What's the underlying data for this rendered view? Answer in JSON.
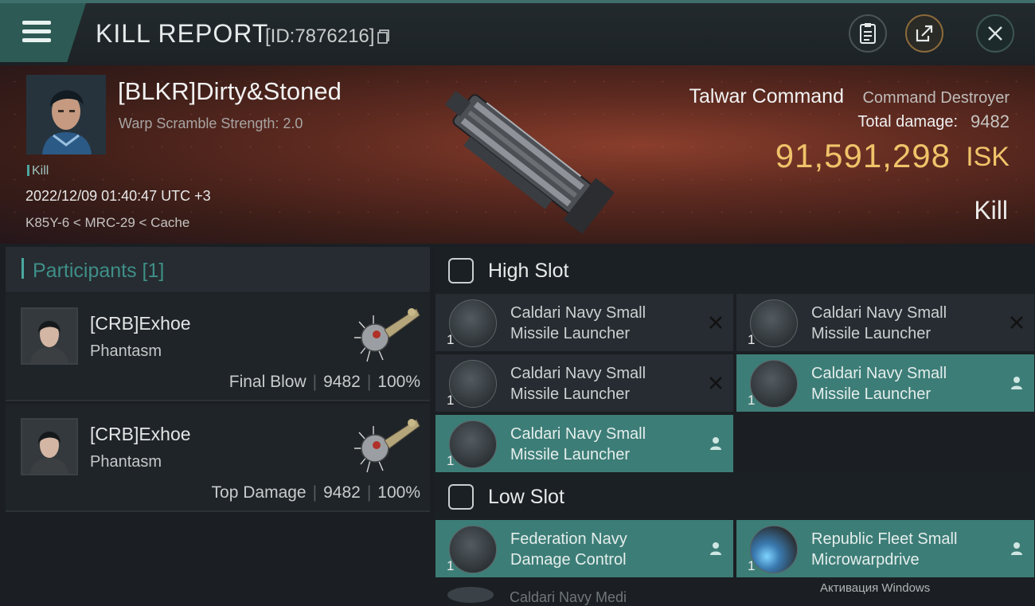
{
  "header": {
    "title": "KILL REPORT",
    "report_id": "[ID:7876216]"
  },
  "victim": {
    "name": "[BLKR]Dirty&Stoned",
    "sub": "Warp Scramble Strength: 2.0",
    "tag": "Kill",
    "datetime": "2022/12/09 01:40:47 UTC +3",
    "location": "K85Y-6 < MRC-29 < Cache"
  },
  "ship": {
    "name": "Talwar Command",
    "class": "Command Destroyer",
    "damage_label": "Total damage:",
    "damage_value": "9482",
    "isk_value": "91,591,298",
    "isk_unit": "ISK",
    "outcome": "Kill"
  },
  "participants": {
    "title": "Participants [1]",
    "rows": [
      {
        "name": "[CRB]Exhoe",
        "ship": "Phantasm",
        "label": "Final Blow",
        "damage": "9482",
        "percent": "100%"
      },
      {
        "name": "[CRB]Exhoe",
        "ship": "Phantasm",
        "label": "Top Damage",
        "damage": "9482",
        "percent": "100%"
      }
    ]
  },
  "high_slot": {
    "title": "High Slot",
    "modules": [
      {
        "line1": "Caldari Navy Small",
        "line2": "Missile Launcher",
        "qty": "1",
        "status": "destroyed"
      },
      {
        "line1": "Caldari Navy Small",
        "line2": "Missile Launcher",
        "qty": "1",
        "status": "destroyed"
      },
      {
        "line1": "Caldari Navy Small",
        "line2": "Missile Launcher",
        "qty": "1",
        "status": "destroyed"
      },
      {
        "line1": "Caldari Navy Small",
        "line2": "Missile Launcher",
        "qty": "1",
        "status": "dropped"
      },
      {
        "line1": "Caldari Navy Small",
        "line2": "Missile Launcher",
        "qty": "1",
        "status": "dropped"
      }
    ]
  },
  "low_slot": {
    "title": "Low Slot",
    "modules": [
      {
        "line1": "Federation Navy",
        "line2": "Damage Control",
        "qty": "1",
        "status": "dropped"
      },
      {
        "line1": "Republic Fleet Small",
        "line2": "Microwarpdrive",
        "qty": "1",
        "status": "dropped"
      }
    ],
    "peek": "Caldari Navy Medi"
  },
  "watermark": "Активация Windows",
  "colors": {
    "accent": "#3d7d77",
    "isk": "#f0c36a",
    "banner": "#5e2a20"
  }
}
